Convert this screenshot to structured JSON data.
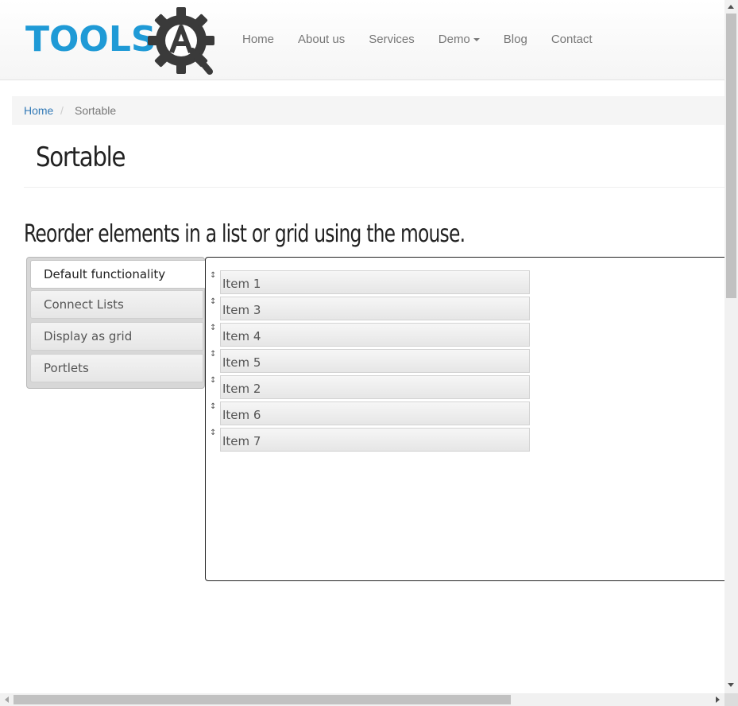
{
  "header": {
    "logo_text": "TOOLS",
    "logo_icon": "gear-wrench-icon",
    "brand_color": "#1f9ad6",
    "nav": [
      {
        "label": "Home"
      },
      {
        "label": "About us"
      },
      {
        "label": "Services"
      },
      {
        "label": "Demo"
      },
      {
        "label": "Blog"
      },
      {
        "label": "Contact"
      }
    ]
  },
  "breadcrumb": {
    "home": "Home",
    "separator": "/",
    "current": "Sortable"
  },
  "page": {
    "title": "Sortable",
    "subtitle": "Reorder elements in a list or grid using the mouse."
  },
  "tabs": [
    {
      "label": "Default functionality",
      "active": true
    },
    {
      "label": "Connect Lists",
      "active": false
    },
    {
      "label": "Display as grid",
      "active": false
    },
    {
      "label": "Portlets",
      "active": false
    }
  ],
  "sortable": {
    "handle_icon": "up-down-arrow-icon",
    "handle_glyph": "↕",
    "items": [
      "Item 1",
      "Item 3",
      "Item 4",
      "Item 5",
      "Item 2",
      "Item 6",
      "Item 7"
    ]
  }
}
